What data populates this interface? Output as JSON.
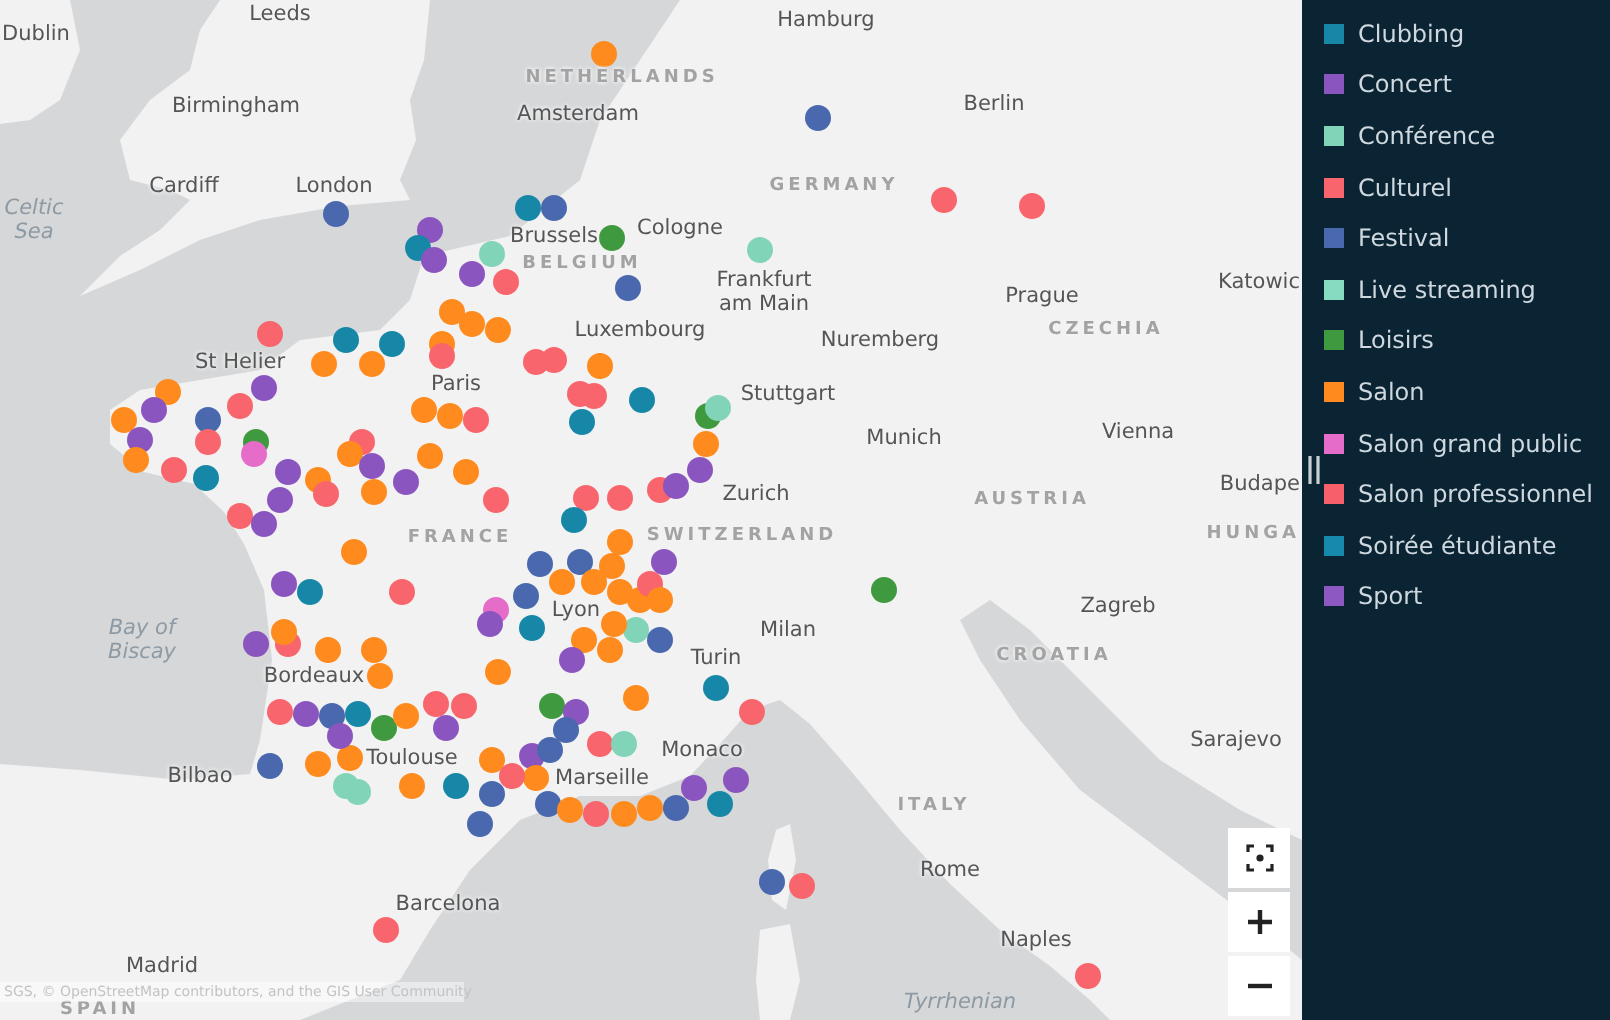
{
  "map": {
    "places": [
      {
        "name": "Leeds",
        "kind": "city"
      },
      {
        "name": "Dublin",
        "kind": "city"
      },
      {
        "name": "Hamburg",
        "kind": "city"
      },
      {
        "name": "NETHERLANDS",
        "kind": "country"
      },
      {
        "name": "Birmingham",
        "kind": "city"
      },
      {
        "name": "Amsterdam",
        "kind": "city"
      },
      {
        "name": "Berlin",
        "kind": "city"
      },
      {
        "name": "Cardiff",
        "kind": "city"
      },
      {
        "name": "London",
        "kind": "city"
      },
      {
        "name": "GERMANY",
        "kind": "country"
      },
      {
        "name": "Celtic Sea",
        "kind": "sea"
      },
      {
        "name": "Brussels",
        "kind": "city"
      },
      {
        "name": "Cologne",
        "kind": "city"
      },
      {
        "name": "BELGIUM",
        "kind": "country"
      },
      {
        "name": "Frankfurt am Main",
        "kind": "city"
      },
      {
        "name": "Prague",
        "kind": "city"
      },
      {
        "name": "Katowic",
        "kind": "city"
      },
      {
        "name": "Luxembourg",
        "kind": "city"
      },
      {
        "name": "CZECHIA",
        "kind": "country"
      },
      {
        "name": "Nuremberg",
        "kind": "city"
      },
      {
        "name": "St Helier",
        "kind": "city"
      },
      {
        "name": "Paris",
        "kind": "city"
      },
      {
        "name": "Stuttgart",
        "kind": "city"
      },
      {
        "name": "Munich",
        "kind": "city"
      },
      {
        "name": "Vienna",
        "kind": "city"
      },
      {
        "name": "Zurich",
        "kind": "city"
      },
      {
        "name": "Budape",
        "kind": "city"
      },
      {
        "name": "AUSTRIA",
        "kind": "country"
      },
      {
        "name": "FRANCE",
        "kind": "country"
      },
      {
        "name": "SWITZERLAND",
        "kind": "country"
      },
      {
        "name": "HUNGA",
        "kind": "country"
      },
      {
        "name": "Zagreb",
        "kind": "city"
      },
      {
        "name": "Lyon",
        "kind": "city"
      },
      {
        "name": "Milan",
        "kind": "city"
      },
      {
        "name": "Bay of Biscay",
        "kind": "sea"
      },
      {
        "name": "Turin",
        "kind": "city"
      },
      {
        "name": "CROATIA",
        "kind": "country"
      },
      {
        "name": "Bordeaux",
        "kind": "city"
      },
      {
        "name": "Sarajevo",
        "kind": "city"
      },
      {
        "name": "Monaco",
        "kind": "city"
      },
      {
        "name": "Toulouse",
        "kind": "city"
      },
      {
        "name": "Marseille",
        "kind": "city"
      },
      {
        "name": "Bilbao",
        "kind": "city"
      },
      {
        "name": "ITALY",
        "kind": "country"
      },
      {
        "name": "Rome",
        "kind": "city"
      },
      {
        "name": "Barcelona",
        "kind": "city"
      },
      {
        "name": "Naples",
        "kind": "city"
      },
      {
        "name": "Madrid",
        "kind": "city"
      },
      {
        "name": "Tyrrhenian",
        "kind": "sea"
      },
      {
        "name": "SPAIN",
        "kind": "country"
      }
    ],
    "markers": [
      {
        "color": "#ff8b1f"
      },
      {
        "color": "#4a68ad"
      },
      {
        "color": "#f8656d"
      },
      {
        "color": "#f8656d"
      },
      {
        "color": "#4a68ad"
      },
      {
        "color": "#8b55bf"
      },
      {
        "color": "#1787a8"
      },
      {
        "color": "#8b55bf"
      },
      {
        "color": "#82d4b8"
      },
      {
        "color": "#8b55bf"
      },
      {
        "color": "#1787a8"
      },
      {
        "color": "#4a68ad"
      },
      {
        "color": "#3f993f"
      },
      {
        "color": "#4a68ad"
      },
      {
        "color": "#f8656d"
      },
      {
        "color": "#82d4b8"
      },
      {
        "color": "#ff8b1f"
      },
      {
        "color": "#ff8b1f"
      },
      {
        "color": "#ff8b1f"
      },
      {
        "color": "#1787a8"
      },
      {
        "color": "#ff8b1f"
      },
      {
        "color": "#ff8b1f"
      },
      {
        "color": "#1787a8"
      },
      {
        "color": "#f8656d"
      },
      {
        "color": "#ff8b1f"
      },
      {
        "color": "#8b55bf"
      },
      {
        "color": "#f8656d"
      },
      {
        "color": "#f8656d"
      },
      {
        "color": "#f8656d"
      },
      {
        "color": "#ff8b1f"
      },
      {
        "color": "#f8656d"
      },
      {
        "color": "#f8656d"
      },
      {
        "color": "#1787a8"
      },
      {
        "color": "#1787a8"
      },
      {
        "color": "#ff8b1f"
      },
      {
        "color": "#ff8b1f"
      },
      {
        "color": "#f8656d"
      },
      {
        "color": "#ff8b1f"
      },
      {
        "color": "#ff8b1f"
      },
      {
        "color": "#8b55bf"
      },
      {
        "color": "#4a68ad"
      },
      {
        "color": "#f8656d"
      },
      {
        "color": "#3f993f"
      },
      {
        "color": "#e56cc8"
      },
      {
        "color": "#f8656d"
      },
      {
        "color": "#1787a8"
      },
      {
        "color": "#f8656d"
      },
      {
        "color": "#8b55bf"
      },
      {
        "color": "#ff8b1f"
      },
      {
        "color": "#8b55bf"
      },
      {
        "color": "#ff8b1f"
      },
      {
        "color": "#f8656d"
      },
      {
        "color": "#ff8b1f"
      },
      {
        "color": "#8b55bf"
      },
      {
        "color": "#ff8b1f"
      },
      {
        "color": "#f8656d"
      },
      {
        "color": "#8b55bf"
      },
      {
        "color": "#8b55bf"
      },
      {
        "color": "#ff8b1f"
      },
      {
        "color": "#ff8b1f"
      },
      {
        "color": "#f8656d"
      },
      {
        "color": "#8b55bf"
      },
      {
        "color": "#ff8b1f"
      },
      {
        "color": "#f8656d"
      },
      {
        "color": "#8b55bf"
      },
      {
        "color": "#1787a8"
      },
      {
        "color": "#f8656d"
      },
      {
        "color": "#f8656d"
      },
      {
        "color": "#f8656d"
      },
      {
        "color": "#f8656d"
      },
      {
        "color": "#8b55bf"
      },
      {
        "color": "#8b55bf"
      },
      {
        "color": "#ff8b1f"
      },
      {
        "color": "#3f993f"
      },
      {
        "color": "#82d4b8"
      },
      {
        "color": "#1787a8"
      },
      {
        "color": "#ff8b1f"
      },
      {
        "color": "#8b55bf"
      },
      {
        "color": "#4a68ad"
      },
      {
        "color": "#4a68ad"
      },
      {
        "color": "#4a68ad"
      },
      {
        "color": "#1787a8"
      },
      {
        "color": "#ff8b1f"
      },
      {
        "color": "#ff8b1f"
      },
      {
        "color": "#ff8b1f"
      },
      {
        "color": "#ff8b1f"
      },
      {
        "color": "#ff8b1f"
      },
      {
        "color": "#f8656d"
      },
      {
        "color": "#ff8b1f"
      },
      {
        "color": "#82d4b8"
      },
      {
        "color": "#ff8b1f"
      },
      {
        "color": "#ff8b1f"
      },
      {
        "color": "#8b55bf"
      },
      {
        "color": "#ff8b1f"
      },
      {
        "color": "#4a68ad"
      },
      {
        "color": "#e56cc8"
      },
      {
        "color": "#8b55bf"
      },
      {
        "color": "#1787a8"
      },
      {
        "color": "#f8656d"
      },
      {
        "color": "#ff8b1f"
      },
      {
        "color": "#ff8b1f"
      },
      {
        "color": "#ff8b1f"
      },
      {
        "color": "#8b55bf"
      },
      {
        "color": "#f8656d"
      },
      {
        "color": "#8b55bf"
      },
      {
        "color": "#4a68ad"
      },
      {
        "color": "#1787a8"
      },
      {
        "color": "#ff8b1f"
      },
      {
        "color": "#3f993f"
      },
      {
        "color": "#ff8b1f"
      },
      {
        "color": "#f8656d"
      },
      {
        "color": "#f8656d"
      },
      {
        "color": "#ff8b1f"
      },
      {
        "color": "#3f993f"
      },
      {
        "color": "#8b55bf"
      },
      {
        "color": "#ff8b1f"
      },
      {
        "color": "#4a68ad"
      },
      {
        "color": "#f8656d"
      },
      {
        "color": "#82d4b8"
      },
      {
        "color": "#8b55bf"
      },
      {
        "color": "#4a68ad"
      },
      {
        "color": "#ff8b1f"
      },
      {
        "color": "#f8656d"
      },
      {
        "color": "#ff8b1f"
      },
      {
        "color": "#ff8b1f"
      },
      {
        "color": "#4a68ad"
      },
      {
        "color": "#8b55bf"
      },
      {
        "color": "#8b55bf"
      },
      {
        "color": "#8b55bf"
      },
      {
        "color": "#ff8b1f"
      },
      {
        "color": "#ff8b1f"
      },
      {
        "color": "#8b55bf"
      },
      {
        "color": "#ff8b1f"
      },
      {
        "color": "#82d4b8"
      },
      {
        "color": "#82d4b8"
      },
      {
        "color": "#4a68ad"
      },
      {
        "color": "#ff8b1f"
      },
      {
        "color": "#f8656d"
      },
      {
        "color": "#1787a8"
      },
      {
        "color": "#4a68ad"
      },
      {
        "color": "#4a68ad"
      },
      {
        "color": "#4a68ad"
      },
      {
        "color": "#ff8b1f"
      },
      {
        "color": "#1787a8"
      },
      {
        "color": "#f8656d"
      },
      {
        "color": "#3f993f"
      },
      {
        "color": "#4a68ad"
      },
      {
        "color": "#f8656d"
      },
      {
        "color": "#f8656d"
      },
      {
        "color": "#f8656d"
      }
    ],
    "attribution": "SGS, © OpenStreetMap contributors, and the GIS User Community"
  },
  "legend": [
    {
      "label": "Clubbing",
      "color": "#1787a8"
    },
    {
      "label": "Concert",
      "color": "#8b55bf"
    },
    {
      "label": "Conférence",
      "color": "#82d4b8"
    },
    {
      "label": "Culturel",
      "color": "#f8656d"
    },
    {
      "label": "Festival",
      "color": "#4a68ad"
    },
    {
      "label": "Live streaming",
      "color": "#86dcc0"
    },
    {
      "label": "Loisirs",
      "color": "#3f993f"
    },
    {
      "label": "Salon",
      "color": "#ff8b1f"
    },
    {
      "label": "Salon grand public",
      "color": "#e56cc8"
    },
    {
      "label": "Salon professionnel",
      "color": "#f7606a"
    },
    {
      "label": "Soirée étudiante",
      "color": "#1689ad"
    },
    {
      "label": "Sport",
      "color": "#8e58c2"
    }
  ]
}
